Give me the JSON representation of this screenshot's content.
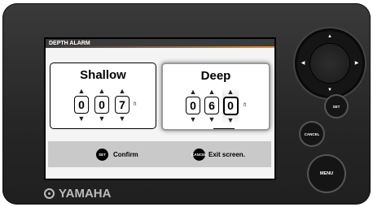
{
  "screen": {
    "title": "DEPTH ALARM",
    "shallow": {
      "label": "Shallow",
      "digits": [
        "0",
        "0",
        "7"
      ],
      "unit": "ft"
    },
    "deep": {
      "label": "Deep",
      "digits": [
        "0",
        "6",
        "0"
      ],
      "unit": "ft"
    },
    "up_arrow": "▲",
    "down_arrow": "▼",
    "softkeys": {
      "set_key": "SET",
      "set_label": "Confirm",
      "cancel_key": "CANCEL",
      "cancel_label": "Exit screen."
    }
  },
  "hardware": {
    "logo": "YAMAHA",
    "set_button": "SET",
    "cancel_button": "CANCEL",
    "menu_button": "MENU",
    "dpad_up": "▲",
    "dpad_down": "▼",
    "dpad_left": "◀",
    "dpad_right": "▶"
  },
  "colors": {
    "bezel": "#2b2b2b",
    "screen_bg": "#f4f4f4",
    "title_bar": "#3b3b3b",
    "title_accent": "#e08a3a",
    "softkey_bar": "#c9c9c9",
    "logo": "#bbbbbb"
  }
}
